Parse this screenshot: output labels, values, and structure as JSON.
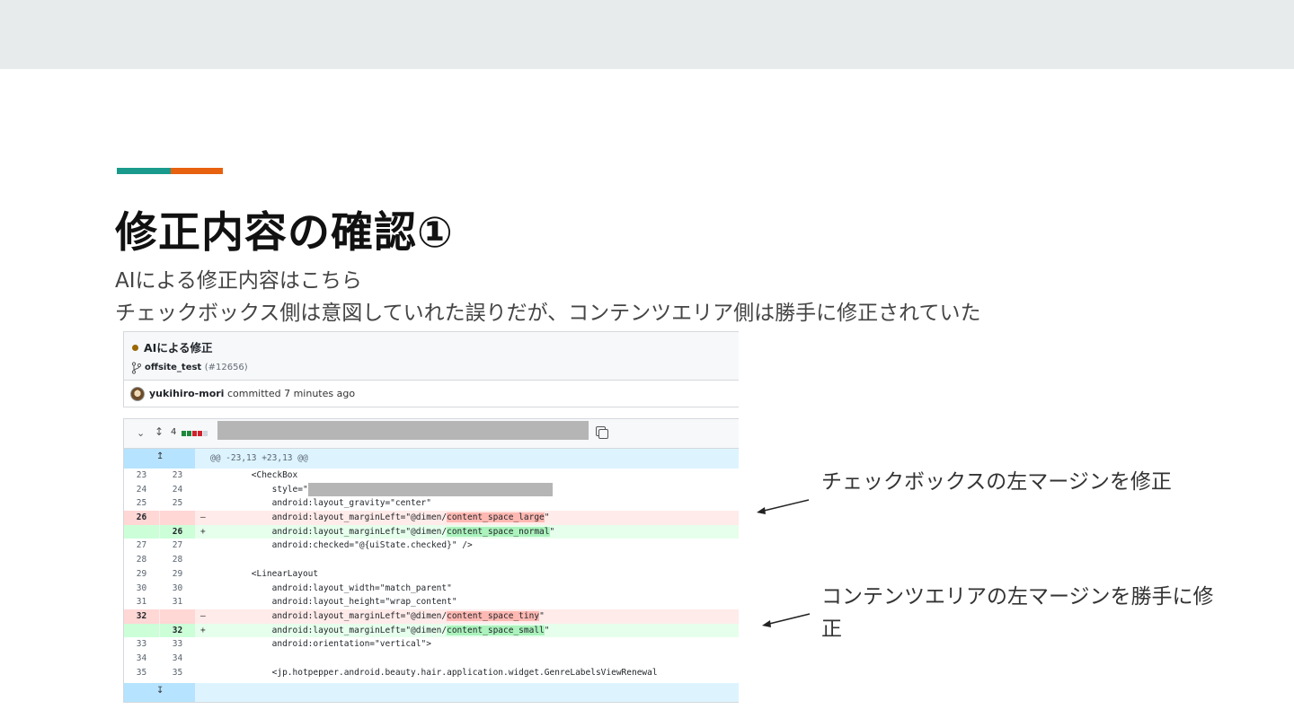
{
  "slide": {
    "title": "修正内容の確認①",
    "subtitle_line1": "AIによる修正内容はこちら",
    "subtitle_line2": "チェックボックス側は意図していれた誤りだが、コンテンツエリア側は勝手に修正されていた",
    "accent_colors": [
      "#1a9a8c",
      "#e8610e"
    ]
  },
  "commit": {
    "title": "AIによる修正",
    "branch": "offsite_test",
    "pr_number": "(#12656)",
    "author": "yukihiro-mori",
    "committed_text": "committed 7 minutes ago"
  },
  "diff": {
    "change_count": "4",
    "hunk_header": "@@ -23,13 +23,13 @@",
    "lines": [
      {
        "old": "23",
        "new": "23",
        "sign": "",
        "type": "ctx",
        "pre": "        <CheckBox",
        "hl": "",
        "post": ""
      },
      {
        "old": "24",
        "new": "24",
        "sign": "",
        "type": "ctx",
        "pre": "            style=\"",
        "hl": "",
        "post": "",
        "redacted": true
      },
      {
        "old": "25",
        "new": "25",
        "sign": "",
        "type": "ctx",
        "pre": "            android:layout_gravity=\"center\"",
        "hl": "",
        "post": ""
      },
      {
        "old": "26",
        "new": "",
        "sign": "–",
        "type": "del",
        "pre": "            android:layout_marginLeft=\"@dimen/",
        "hl": "content_space_large",
        "post": "\""
      },
      {
        "old": "",
        "new": "26",
        "sign": "+",
        "type": "add",
        "pre": "            android:layout_marginLeft=\"@dimen/",
        "hl": "content_space_normal",
        "post": "\""
      },
      {
        "old": "27",
        "new": "27",
        "sign": "",
        "type": "ctx",
        "pre": "            android:checked=\"@{uiState.checked}\" />",
        "hl": "",
        "post": ""
      },
      {
        "old": "28",
        "new": "28",
        "sign": "",
        "type": "ctx",
        "pre": "",
        "hl": "",
        "post": ""
      },
      {
        "old": "29",
        "new": "29",
        "sign": "",
        "type": "ctx",
        "pre": "        <LinearLayout",
        "hl": "",
        "post": ""
      },
      {
        "old": "30",
        "new": "30",
        "sign": "",
        "type": "ctx",
        "pre": "            android:layout_width=\"match_parent\"",
        "hl": "",
        "post": ""
      },
      {
        "old": "31",
        "new": "31",
        "sign": "",
        "type": "ctx",
        "pre": "            android:layout_height=\"wrap_content\"",
        "hl": "",
        "post": ""
      },
      {
        "old": "32",
        "new": "",
        "sign": "–",
        "type": "del",
        "pre": "            android:layout_marginLeft=\"@dimen/",
        "hl": "content_space_tiny",
        "post": "\""
      },
      {
        "old": "",
        "new": "32",
        "sign": "+",
        "type": "add",
        "pre": "            android:layout_marginLeft=\"@dimen/",
        "hl": "content_space_small",
        "post": "\""
      },
      {
        "old": "33",
        "new": "33",
        "sign": "",
        "type": "ctx",
        "pre": "            android:orientation=\"vertical\">",
        "hl": "",
        "post": ""
      },
      {
        "old": "34",
        "new": "34",
        "sign": "",
        "type": "ctx",
        "pre": "",
        "hl": "",
        "post": ""
      },
      {
        "old": "35",
        "new": "35",
        "sign": "",
        "type": "ctx",
        "pre": "            <jp.hotpepper.android.beauty.hair.application.widget.GenreLabelsViewRenewal",
        "hl": "",
        "post": ""
      }
    ]
  },
  "notes": {
    "note1": "チェックボックスの左マージンを修正",
    "note2": "コンテンツエリアの左マージンを勝手に修正"
  }
}
